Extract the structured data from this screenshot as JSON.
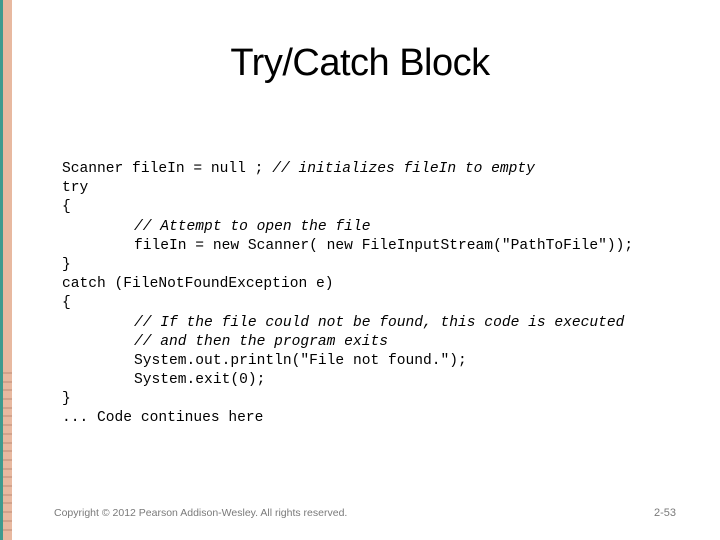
{
  "slide": {
    "title": "Try/Catch Block",
    "code_lines": [
      {
        "indent": false,
        "parts": [
          {
            "text": "Scanner fileIn = null ; ",
            "comment": false
          },
          {
            "text": "// initializes fileIn to empty",
            "comment": true
          }
        ]
      },
      {
        "indent": false,
        "parts": [
          {
            "text": "try",
            "comment": false
          }
        ]
      },
      {
        "indent": false,
        "parts": [
          {
            "text": "{",
            "comment": false
          }
        ]
      },
      {
        "indent": true,
        "parts": [
          {
            "text": "// Attempt to open the file",
            "comment": true
          }
        ]
      },
      {
        "indent": true,
        "parts": [
          {
            "text": "fileIn = new Scanner( new FileInputStream(\"PathToFile\"));",
            "comment": false
          }
        ]
      },
      {
        "indent": false,
        "parts": [
          {
            "text": "}",
            "comment": false
          }
        ]
      },
      {
        "indent": false,
        "parts": [
          {
            "text": "catch (FileNotFoundException e)",
            "comment": false
          }
        ]
      },
      {
        "indent": false,
        "parts": [
          {
            "text": "{",
            "comment": false
          }
        ]
      },
      {
        "indent": true,
        "parts": [
          {
            "text": "// If the file could not be found, this code is executed",
            "comment": true
          }
        ]
      },
      {
        "indent": true,
        "parts": [
          {
            "text": "// and then the program exits",
            "comment": true
          }
        ]
      },
      {
        "indent": true,
        "parts": [
          {
            "text": "System.out.println(\"File not found.\");",
            "comment": false
          }
        ]
      },
      {
        "indent": true,
        "parts": [
          {
            "text": "System.exit(0);",
            "comment": false
          }
        ]
      },
      {
        "indent": false,
        "parts": [
          {
            "text": "}",
            "comment": false
          }
        ]
      },
      {
        "indent": false,
        "parts": [
          {
            "text": "... Code continues here",
            "comment": false
          }
        ]
      }
    ]
  },
  "footer": {
    "copyright": "Copyright © 2012 Pearson Addison-Wesley. All rights reserved.",
    "page_number": "2-53"
  },
  "theme": {
    "stripe_teal": "#3e9a8e",
    "stripe_peach": "#e8b9a0",
    "footer_text": "#7a7a7a"
  }
}
